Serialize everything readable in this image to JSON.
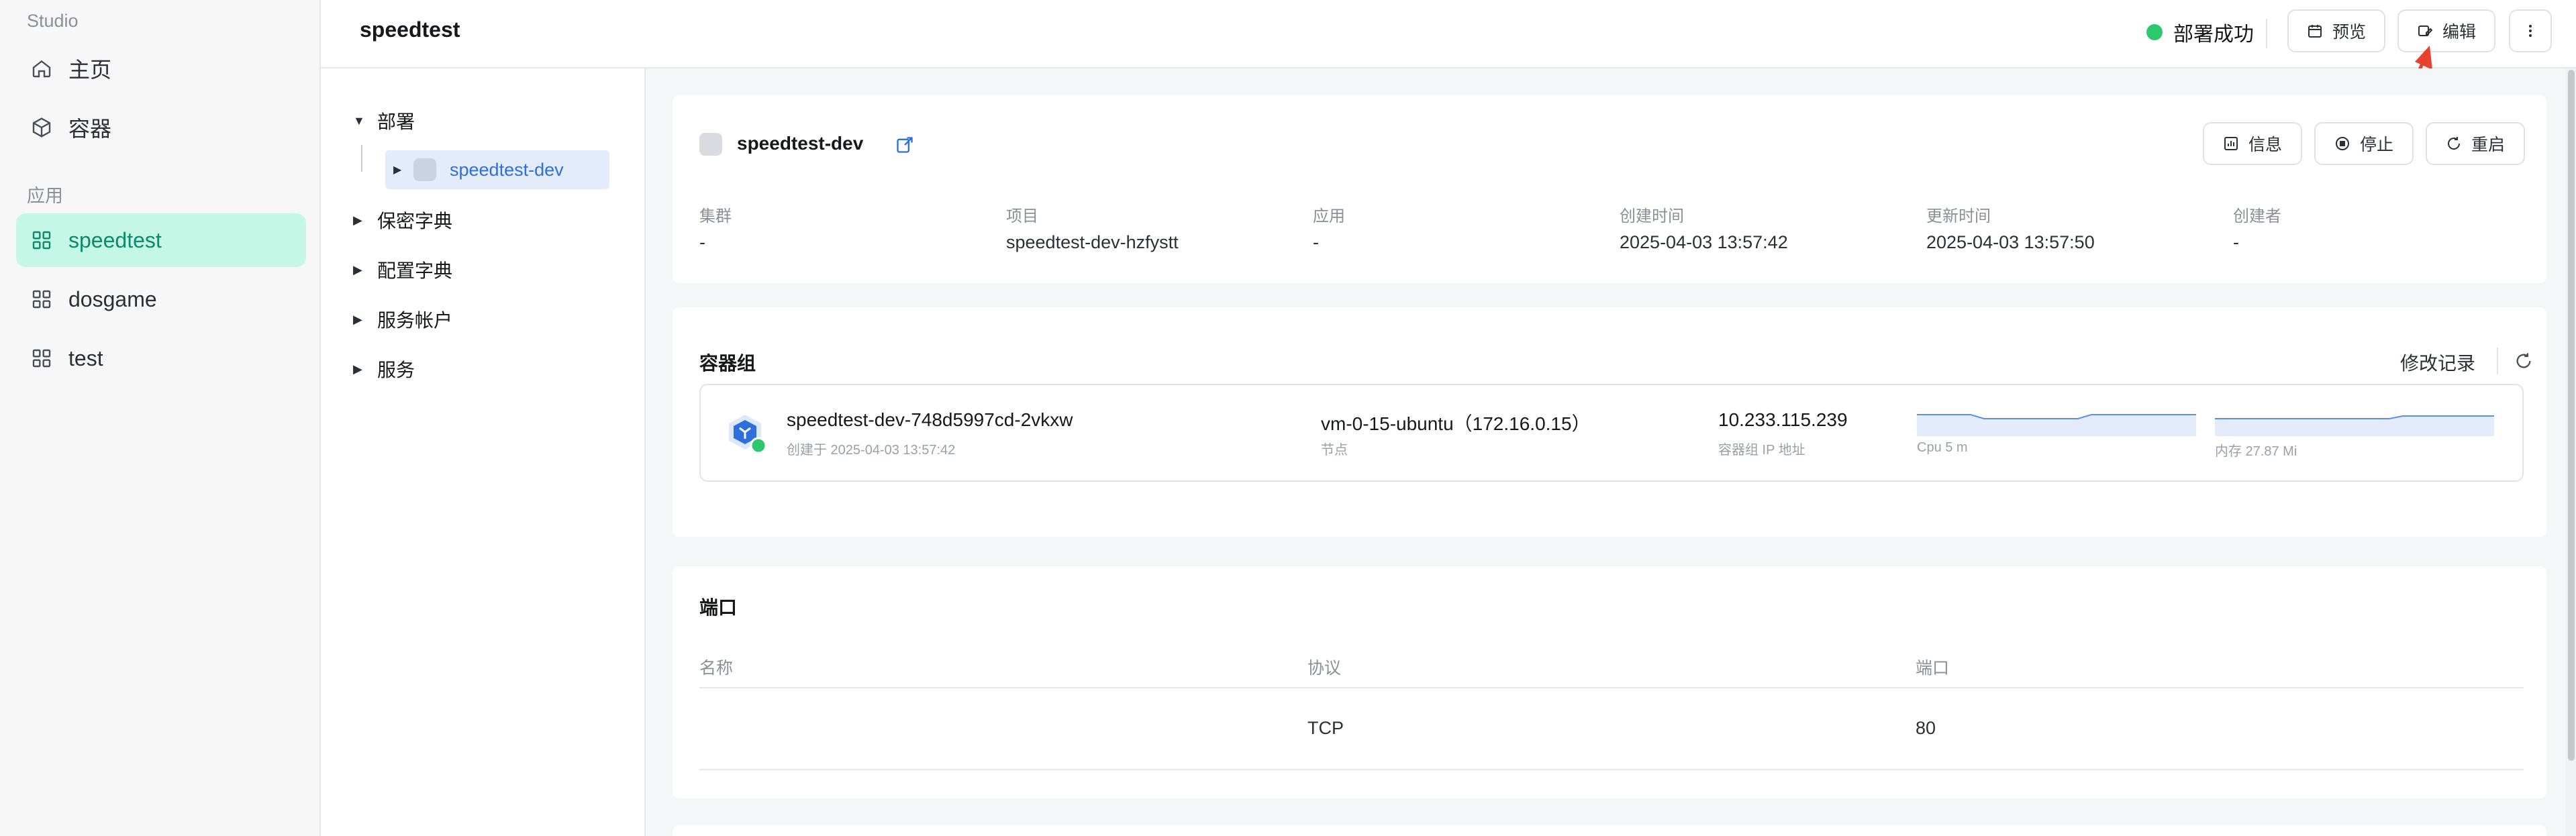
{
  "sidebar": {
    "section_studio": "Studio",
    "section_apps": "应用",
    "nav": [
      {
        "label": "主页",
        "icon": "home-icon"
      },
      {
        "label": "容器",
        "icon": "cube-icon"
      }
    ],
    "apps": [
      {
        "label": "speedtest",
        "icon": "grid-icon",
        "active": true
      },
      {
        "label": "dosgame",
        "icon": "grid-icon"
      },
      {
        "label": "test",
        "icon": "grid-icon"
      }
    ]
  },
  "header": {
    "title": "speedtest",
    "status": "部署成功",
    "status_color": "#2dc76d",
    "preview_label": "预览",
    "edit_label": "编辑"
  },
  "tree": {
    "deployments": "部署",
    "deployment_item": "speedtest-dev",
    "secrets": "保密字典",
    "configmaps": "配置字典",
    "service_accounts": "服务帐户",
    "services": "服务"
  },
  "deployment": {
    "name": "speedtest-dev",
    "info_label": "信息",
    "stop_label": "停止",
    "restart_label": "重启",
    "meta": [
      {
        "label": "集群",
        "value": "-"
      },
      {
        "label": "项目",
        "value": "speedtest-dev-hzfystt"
      },
      {
        "label": "应用",
        "value": "-"
      },
      {
        "label": "创建时间",
        "value": "2025-04-03 13:57:42"
      },
      {
        "label": "更新时间",
        "value": "2025-04-03 13:57:50"
      },
      {
        "label": "创建者",
        "value": "-"
      }
    ]
  },
  "pods": {
    "title": "容器组",
    "history_label": "修改记录",
    "items": [
      {
        "name": "speedtest-dev-748d5997cd-2vkxw",
        "created": "创建于 2025-04-03 13:57:42",
        "node": "vm-0-15-ubuntu（172.16.0.15）",
        "node_label": "节点",
        "ip": "10.233.115.239",
        "ip_label": "容器组 IP 地址",
        "cpu_label": "Cpu 5 m",
        "mem_label": "内存 27.87 Mi"
      }
    ]
  },
  "ports": {
    "title": "端口",
    "columns": [
      "名称",
      "协议",
      "端口"
    ],
    "rows": [
      {
        "name": "",
        "protocol": "TCP",
        "port": "80"
      }
    ]
  },
  "colors": {
    "accent": "#2d6fdc",
    "active_bg": "#c4f7e6",
    "active_text": "#0d8a6a",
    "arrow": "#e8412f"
  }
}
